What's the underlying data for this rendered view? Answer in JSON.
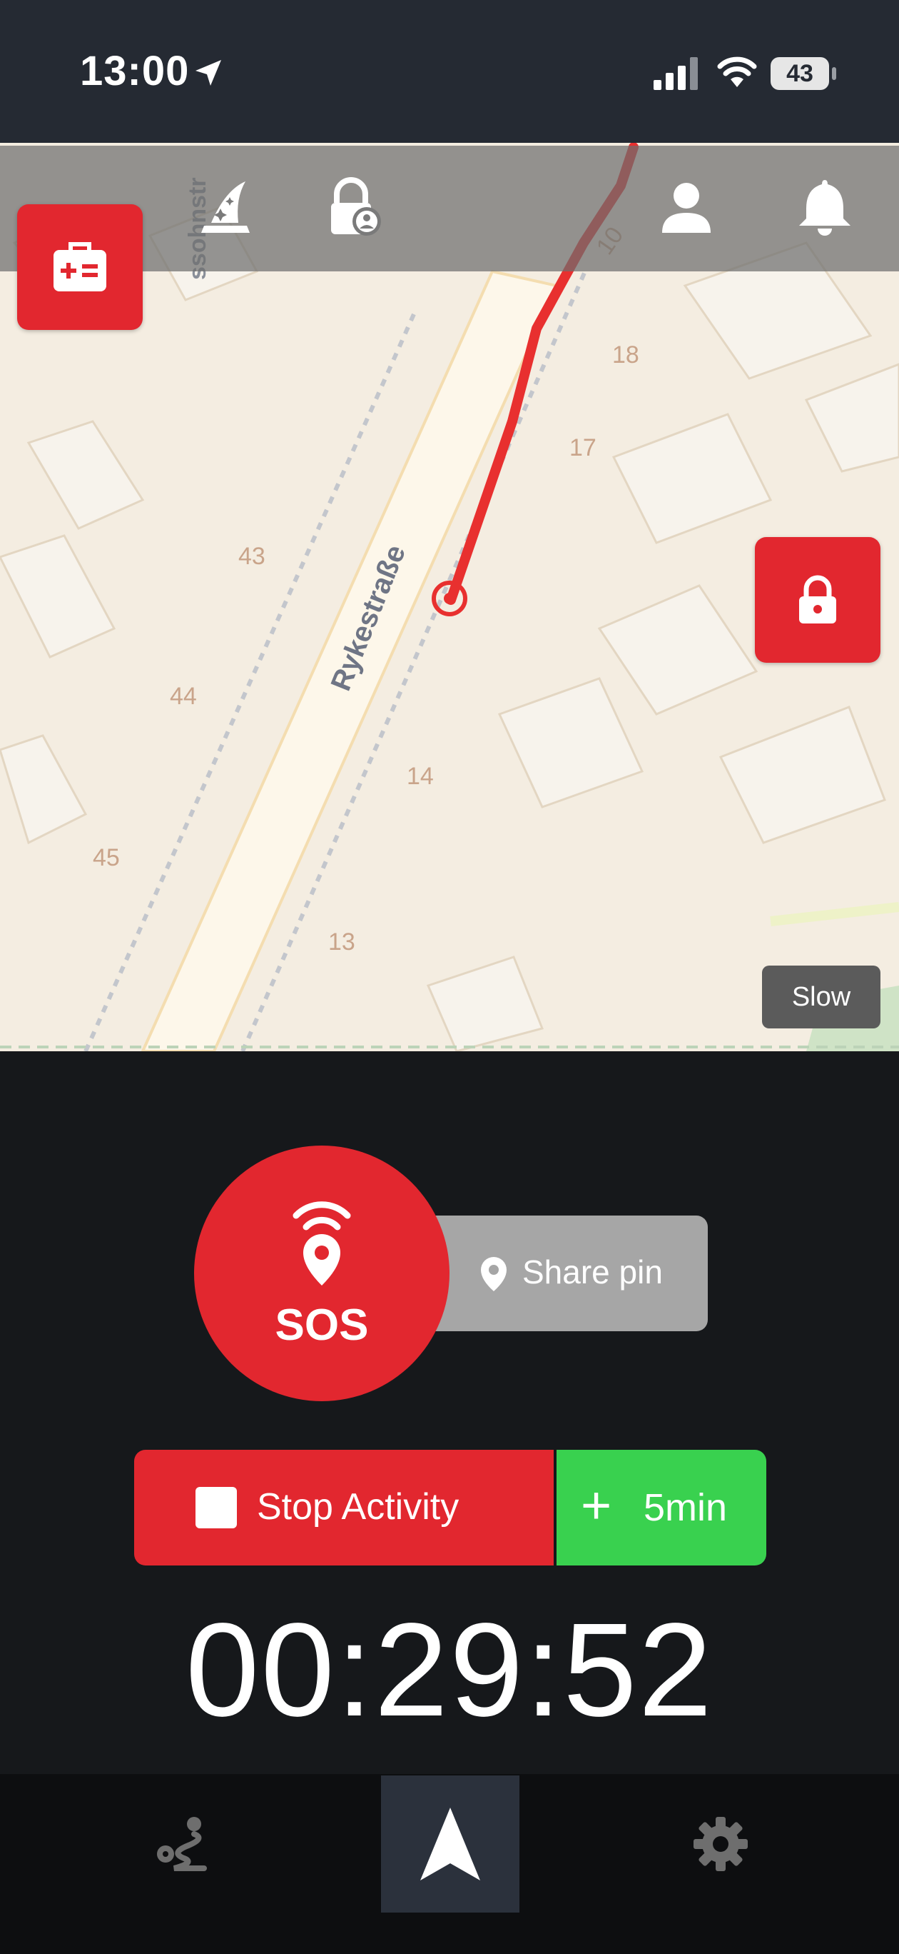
{
  "status_bar": {
    "time": "13:00",
    "battery": "43"
  },
  "map": {
    "street_name": "Rykestraße",
    "street_name_partial": "ssohnstr",
    "house_numbers": [
      "10",
      "18",
      "17",
      "43",
      "44",
      "14",
      "45",
      "13"
    ],
    "speed_label": "Slow",
    "track_color": "#e8302f"
  },
  "actions": {
    "sos_label": "SOS",
    "share_pin_label": "Share pin",
    "stop_label": "Stop Activity",
    "add_label": "5min"
  },
  "timer": "00:29:52",
  "nav": {
    "items": [
      {
        "icon": "route-icon"
      },
      {
        "icon": "navigation-arrow-icon",
        "active": true
      },
      {
        "icon": "gear-icon"
      }
    ]
  },
  "colors": {
    "accent_red": "#e2272f",
    "accent_green": "#39d14f",
    "background": "#16181b"
  }
}
